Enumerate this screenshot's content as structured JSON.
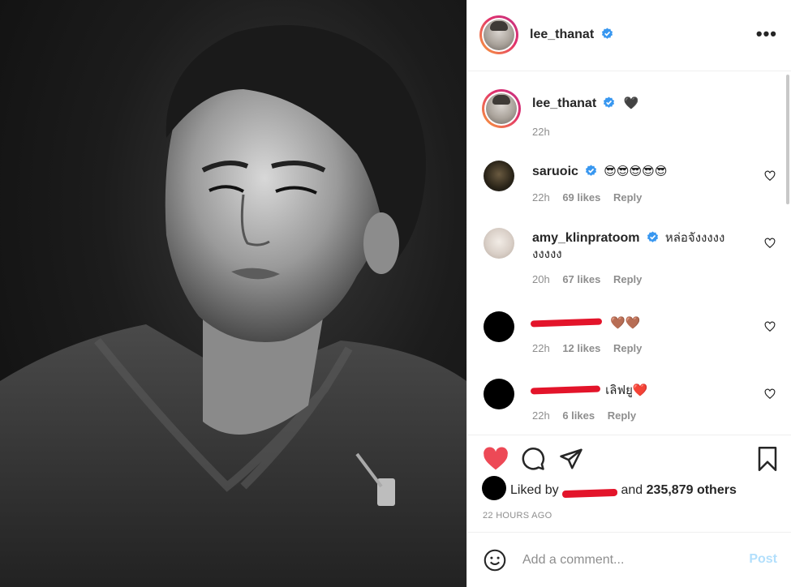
{
  "post": {
    "author": "lee_thanat",
    "caption_emoji": "🖤"
  },
  "header": {
    "username": "lee_thanat",
    "more_label": "•••"
  },
  "caption": {
    "username": "lee_thanat",
    "text": "🖤",
    "time": "22h"
  },
  "comments": [
    {
      "username": "saruoic",
      "verified": true,
      "text": "😎😎😎😎😎",
      "time": "22h",
      "likes": "69 likes",
      "reply": "Reply"
    },
    {
      "username": "amy_klinpratoom",
      "verified": true,
      "text": "หล่อจังงงงง",
      "text_line2": "งงงงง",
      "time": "20h",
      "likes": "67 likes",
      "reply": "Reply"
    },
    {
      "username": "",
      "text": "🤎🤎",
      "time": "22h",
      "likes": "12 likes",
      "reply": "Reply"
    },
    {
      "username": "",
      "text": "เลิฟยู❤️",
      "time": "22h",
      "likes": "6 likes",
      "reply": "Reply"
    }
  ],
  "likes": {
    "prefix": "Liked by",
    "and": "and",
    "count": "235,879 others"
  },
  "timestamp": "22 HOURS AGO",
  "add_comment": {
    "placeholder": "Add a comment...",
    "post_label": "Post"
  },
  "colors": {
    "like_red": "#ed4956",
    "verified_blue": "#3897f0",
    "post_disabled": "#b2dffc"
  }
}
